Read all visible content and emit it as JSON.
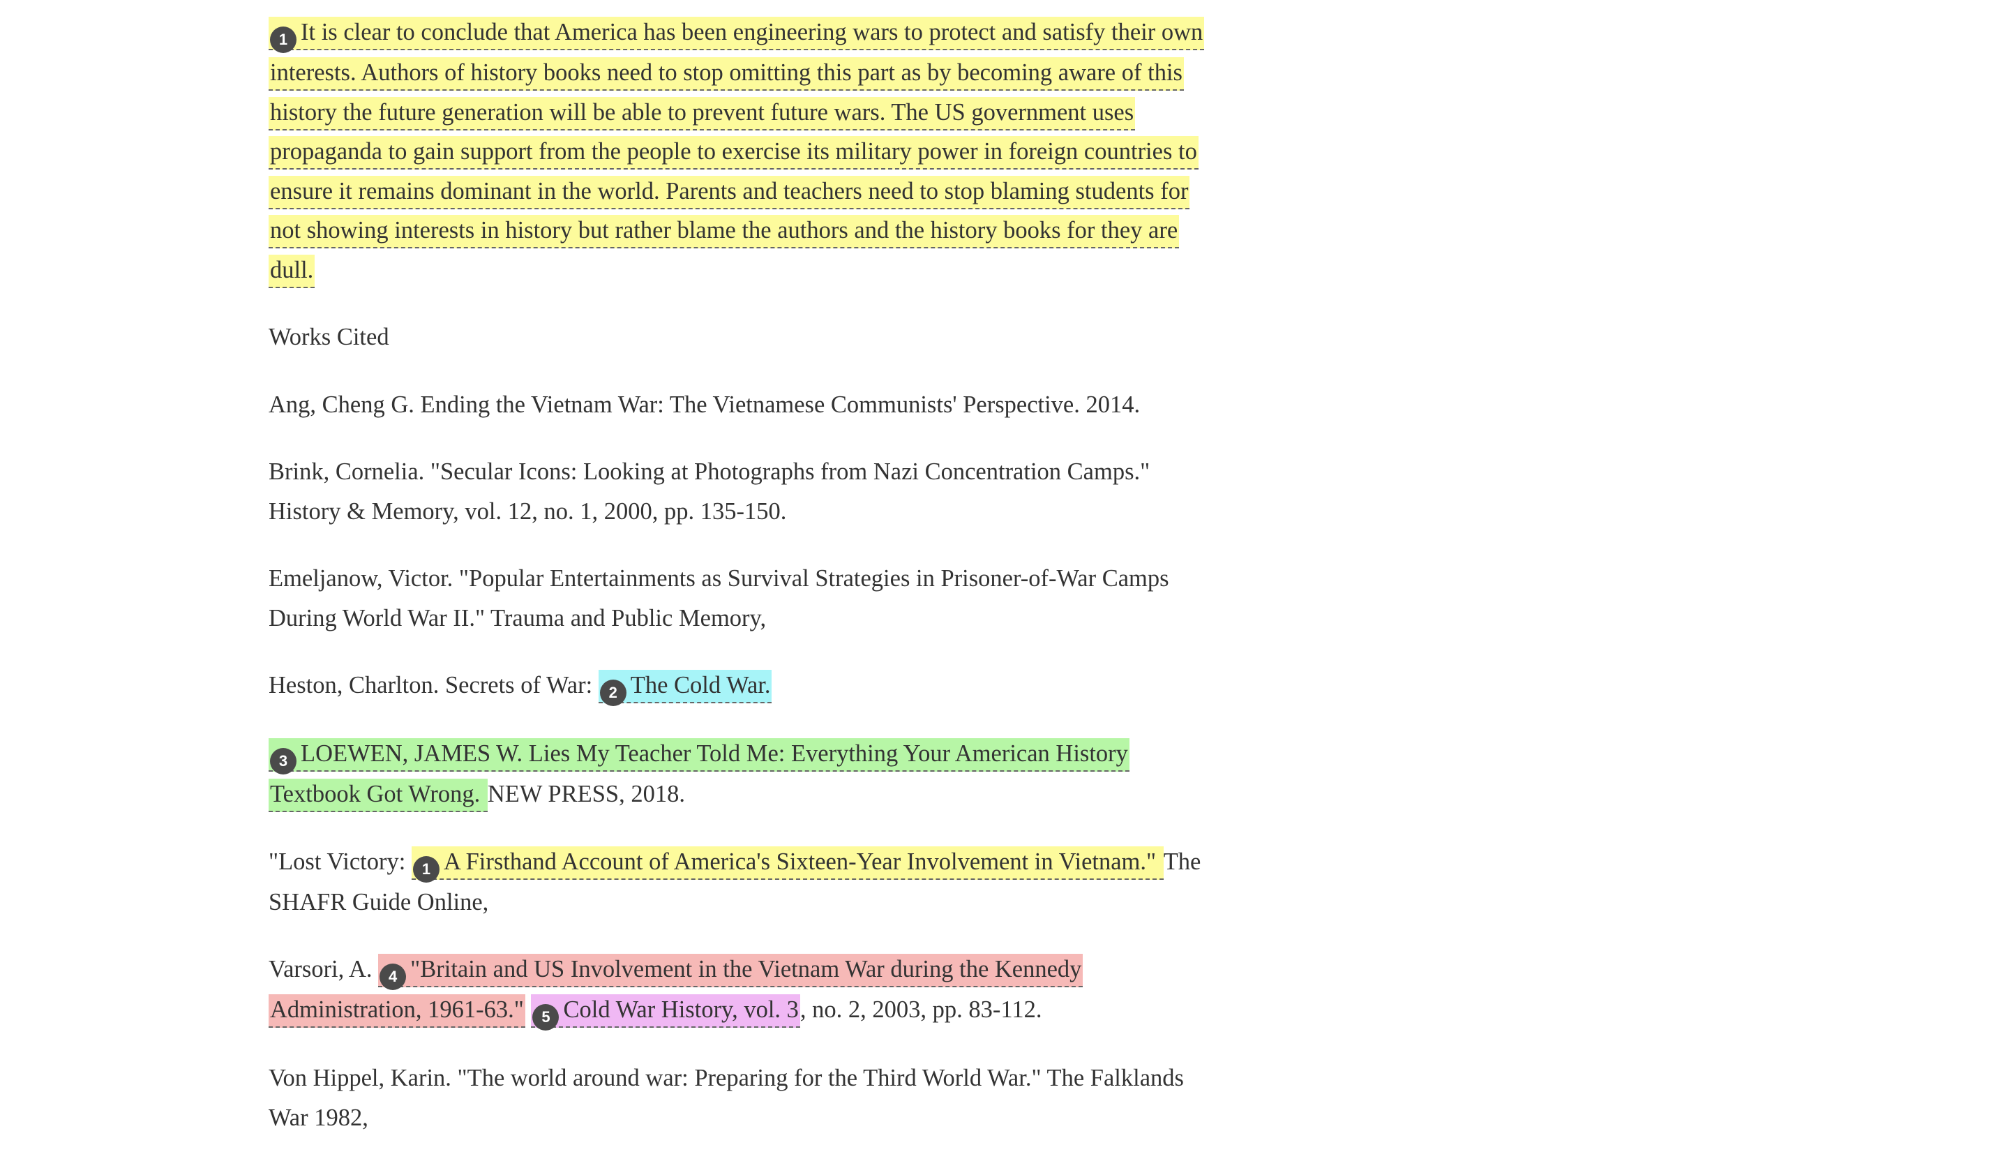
{
  "conclusion": {
    "badge": "1",
    "text": "It is clear to conclude that America has been engineering wars to protect and satisfy their own interests.  Authors of history books need to stop omitting this part as by becoming aware of this history the future generation will be able to prevent future wars.  The US government uses propaganda to gain support from the people to exercise its military power in foreign countries to ensure it remains dominant in the world.  Parents and teachers need to stop blaming students for not showing interests in history but rather blame the authors and the history books for they are dull."
  },
  "works_cited": {
    "heading": "Works Cited",
    "entries": [
      {
        "text": "Ang, Cheng G. Ending the Vietnam War: The Vietnamese Communists' Perspective. 2014."
      },
      {
        "text": "Brink, Cornelia. \"Secular Icons: Looking at Photographs from Nazi Concentration Camps.\" History & Memory, vol. 12, no. 1, 2000, pp. 135-150."
      },
      {
        "text": "Emeljanow, Victor. \"Popular Entertainments as Survival Strategies in Prisoner-of-War Camps During World War II.\" Trauma and Public Memory,"
      },
      {
        "pre": "Heston, Charlton. Secrets of War: ",
        "badge": "2",
        "highlight": "The Cold War."
      },
      {
        "badge": "3",
        "highlight": "LOEWEN, JAMES W.  Lies My Teacher Told Me:  Everything Your American History Textbook Got Wrong. ",
        "post": "NEW PRESS, 2018."
      },
      {
        "pre": "\"Lost Victory: ",
        "badge": "1",
        "highlight": "A Firsthand Account of America's Sixteen-Year Involvement in Vietnam.\" ",
        "post": "The SHAFR Guide Online,"
      },
      {
        "pre": "Varsori, A. ",
        "badge": "4",
        "highlight": "\"Britain and US Involvement in the Vietnam War during the Kennedy Administration, 1961-63.\"",
        "mid": " ",
        "badge2": "5",
        "highlight2": "Cold War History, vol. 3",
        "post": ", no. 2, 2003, pp. 83-112."
      },
      {
        "text": "Von Hippel, Karin. \"The world around war: Preparing for the Third World War.\" The Falklands War 1982,"
      }
    ]
  },
  "colors": {
    "yellow": "#fdfb9c",
    "cyan": "#a7f4f8",
    "green": "#b7f6a6",
    "red": "#f6b9b7",
    "purple": "#f0b8f4",
    "badge": "#4a4a4a"
  }
}
